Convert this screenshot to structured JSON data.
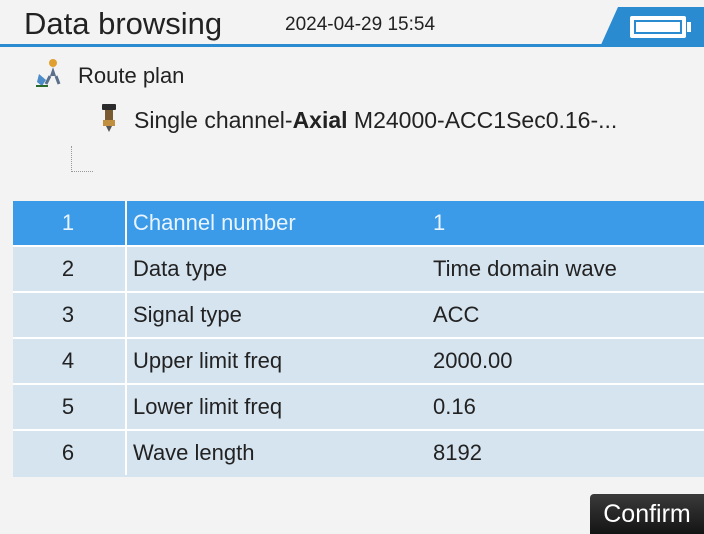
{
  "header": {
    "title": "Data browsing",
    "datetime": "2024-04-29 15:54",
    "battery_icon": "battery-icon",
    "accent_color": "#2a8bd1"
  },
  "tree": {
    "root": {
      "icon": "route-plan-icon",
      "label": "Route plan"
    },
    "child": {
      "icon": "sensor-icon",
      "label_prefix": "Single channel-",
      "label_bold": "Axial",
      "label_suffix": " M24000-ACC1Sec0.16-..."
    }
  },
  "table": {
    "selected_index": 0,
    "selected_color": "#3b9be8",
    "row_color": "#d6e4f0",
    "rows": [
      {
        "index": "1",
        "name": "Channel number",
        "value": "1"
      },
      {
        "index": "2",
        "name": "Data type",
        "value": "Time domain wave"
      },
      {
        "index": "3",
        "name": "Signal type",
        "value": "ACC"
      },
      {
        "index": "4",
        "name": "Upper limit freq",
        "value": "2000.00"
      },
      {
        "index": "5",
        "name": "Lower limit freq",
        "value": "0.16"
      },
      {
        "index": "6",
        "name": "Wave length",
        "value": "8192"
      }
    ]
  },
  "footer": {
    "confirm_label": "Confirm"
  }
}
